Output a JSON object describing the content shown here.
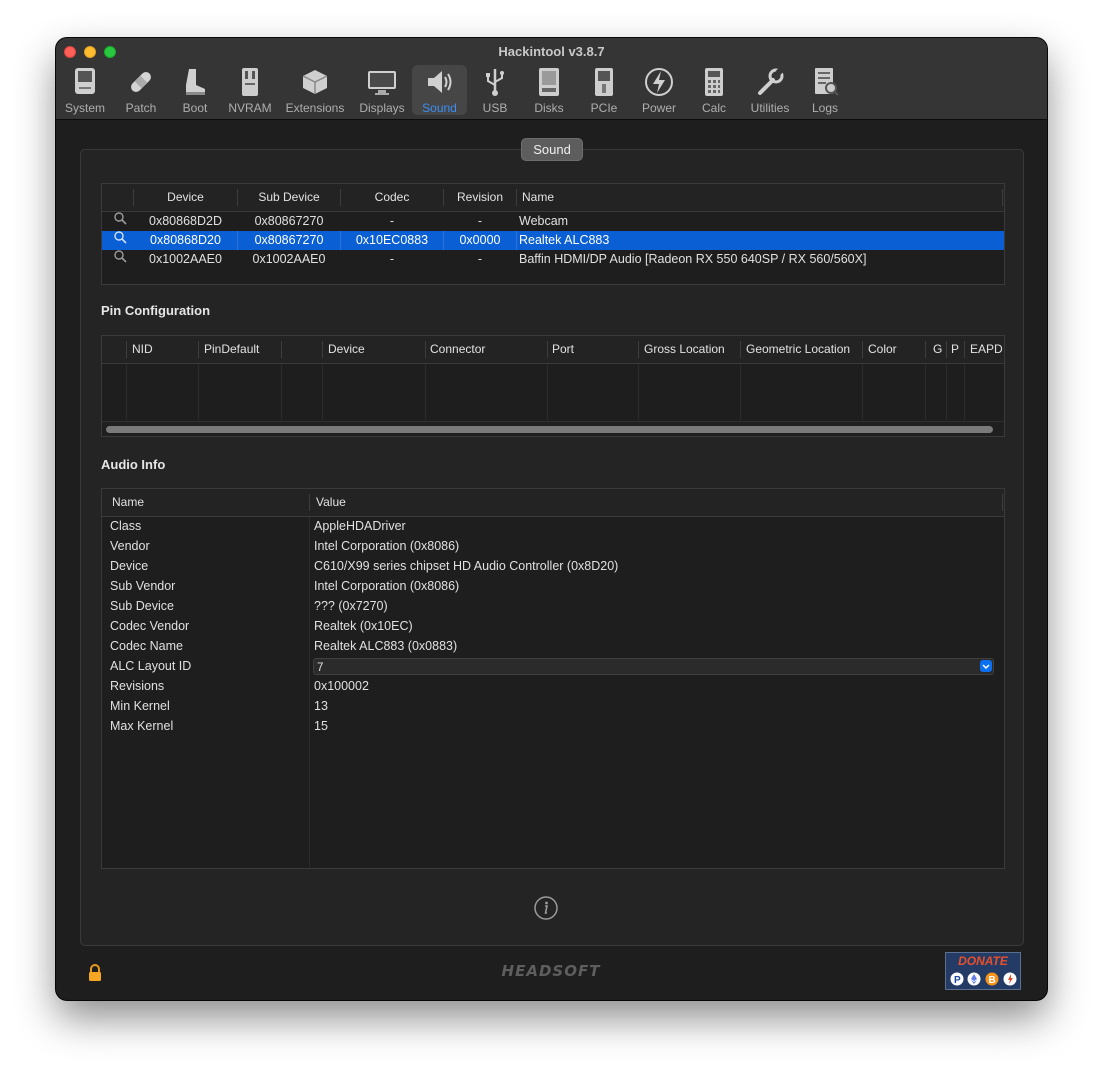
{
  "window": {
    "title": "Hackintool v3.8.7"
  },
  "toolbar": [
    {
      "label": "System",
      "icon": "system-icon",
      "active": false
    },
    {
      "label": "Patch",
      "icon": "patch-icon",
      "active": false
    },
    {
      "label": "Boot",
      "icon": "boot-icon",
      "active": false
    },
    {
      "label": "NVRAM",
      "icon": "nvram-icon",
      "active": false
    },
    {
      "label": "Extensions",
      "icon": "extensions-icon",
      "active": false
    },
    {
      "label": "Displays",
      "icon": "displays-icon",
      "active": false
    },
    {
      "label": "Sound",
      "icon": "sound-icon",
      "active": true
    },
    {
      "label": "USB",
      "icon": "usb-icon",
      "active": false
    },
    {
      "label": "Disks",
      "icon": "disks-icon",
      "active": false
    },
    {
      "label": "PCIe",
      "icon": "pcie-icon",
      "active": false
    },
    {
      "label": "Power",
      "icon": "power-icon",
      "active": false
    },
    {
      "label": "Calc",
      "icon": "calc-icon",
      "active": false
    },
    {
      "label": "Utilities",
      "icon": "utilities-icon",
      "active": false
    },
    {
      "label": "Logs",
      "icon": "logs-icon",
      "active": false
    }
  ],
  "panel": {
    "tab_label": "Sound"
  },
  "devices": {
    "headers": [
      "Device",
      "Sub Device",
      "Codec",
      "Revision",
      "Name"
    ],
    "rows": [
      {
        "device": "0x80868D2D",
        "sub_device": "0x80867270",
        "codec": "-",
        "revision": "-",
        "name": "Webcam",
        "selected": false
      },
      {
        "device": "0x80868D20",
        "sub_device": "0x80867270",
        "codec": "0x10EC0883",
        "revision": "0x0000",
        "name": "Realtek ALC883",
        "selected": true
      },
      {
        "device": "0x1002AAE0",
        "sub_device": "0x1002AAE0",
        "codec": "-",
        "revision": "-",
        "name": "Baffin HDMI/DP Audio [Radeon RX 550 640SP / RX 560/560X]",
        "selected": false
      }
    ]
  },
  "pin_config": {
    "title": "Pin Configuration",
    "headers": [
      "NID",
      "PinDefault",
      "Device",
      "Connector",
      "Port",
      "Gross Location",
      "Geometric Location",
      "Color",
      "G",
      "P",
      "EAPD"
    ]
  },
  "audio_info": {
    "title": "Audio Info",
    "headers": [
      "Name",
      "Value"
    ],
    "rows": [
      {
        "name": "Class",
        "value": "AppleHDADriver"
      },
      {
        "name": "Vendor",
        "value": "Intel Corporation (0x8086)"
      },
      {
        "name": "Device",
        "value": "C610/X99 series chipset HD Audio Controller (0x8D20)"
      },
      {
        "name": "Sub Vendor",
        "value": "Intel Corporation (0x8086)"
      },
      {
        "name": "Sub Device",
        "value": "??? (0x7270)"
      },
      {
        "name": "Codec Vendor",
        "value": "Realtek (0x10EC)"
      },
      {
        "name": "Codec Name",
        "value": "Realtek ALC883 (0x0883)"
      },
      {
        "name": "ALC Layout ID",
        "value": "7",
        "control": "dropdown"
      },
      {
        "name": "Revisions",
        "value": "0x100002"
      },
      {
        "name": "Min Kernel",
        "value": "13"
      },
      {
        "name": "Max Kernel",
        "value": "15"
      }
    ]
  },
  "footer": {
    "brand": "HEADSOFT",
    "donate_label": "DONATE"
  },
  "colors": {
    "accent": "#3b8ef6",
    "selection": "#0a5fd4",
    "donate": "#e9502a"
  }
}
